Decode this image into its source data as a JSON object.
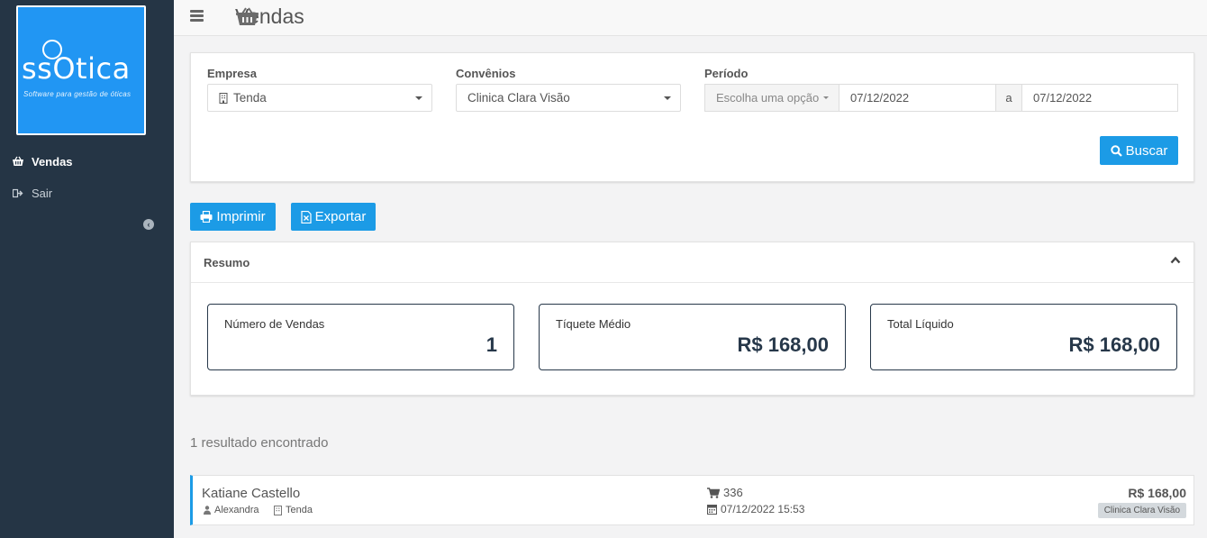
{
  "sidebar": {
    "logo_text": "ssOtica",
    "logo_subtitle": "Software para gestão de óticas",
    "items": [
      {
        "label": "Vendas",
        "icon": "basket-icon",
        "active": true
      },
      {
        "label": "Sair",
        "icon": "sign-out-icon",
        "active": false
      }
    ],
    "collapse_icon": "chevron-left-circle-icon"
  },
  "header": {
    "title": "Vendas",
    "icon": "basket-icon"
  },
  "filters": {
    "empresa_label": "Empresa",
    "empresa_value": "Tenda",
    "convenios_label": "Convênios",
    "convenios_value": "Clinica Clara Visão",
    "periodo_label": "Período",
    "periodo_option": "Escolha uma opção",
    "date_from": "07/12/2022",
    "date_separator": "a",
    "date_to": "07/12/2022",
    "search_button": "Buscar"
  },
  "actions": {
    "print_button": "Imprimir",
    "export_button": "Exportar"
  },
  "summary": {
    "title": "Resumo",
    "cards": [
      {
        "label": "Número de Vendas",
        "value": "1"
      },
      {
        "label": "Tíquete Médio",
        "value": "R$ 168,00"
      },
      {
        "label": "Total Líquido",
        "value": "R$ 168,00"
      }
    ]
  },
  "results": {
    "count_text": "1 resultado encontrado",
    "items": [
      {
        "client": "Katiane Castello",
        "seller": "Alexandra",
        "store": "Tenda",
        "order_number": "336",
        "datetime": "07/12/2022 15:53",
        "amount": "R$ 168,00",
        "agreement_tag": "Clinica Clara Visão"
      }
    ]
  },
  "colors": {
    "sidebar_bg": "#253545",
    "accent": "#1c9be6",
    "logo_bg": "#2196f3",
    "stat_border": "#27384a"
  }
}
